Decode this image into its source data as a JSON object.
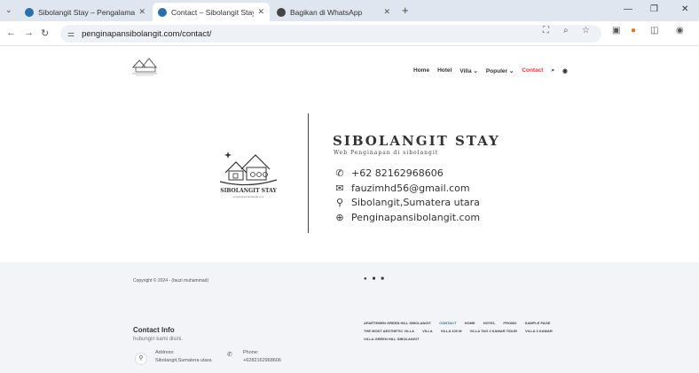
{
  "browser": {
    "tabs": [
      {
        "title": "Sibolangit Stay – Pengalaman I",
        "active": false
      },
      {
        "title": "Contact – Sibolangit Stay",
        "active": true
      },
      {
        "title": "Bagikan di WhatsApp",
        "active": false
      }
    ],
    "url": "penginapansibolangit.com/contact/"
  },
  "header": {
    "nav": [
      "Home",
      "Hotel",
      "Villa ⌄",
      "Populer ⌄",
      "Contact"
    ]
  },
  "hero": {
    "brand": "SIBOLANGIT STAY",
    "tagline": "Web Penginapan di sibolangit",
    "logo_text": "SIBOLANGIT STAY",
    "logo_sub": "penginapansibolangit.com",
    "phone": "+62 82162968606",
    "email": "fauzimhd56@gmail.com",
    "location": "Sibolangit,Sumatera utara",
    "website": "Penginapansibolangit.com"
  },
  "footer": {
    "copyright": "Copyright © 2024 - (fauzi muhammad)",
    "contact_title": "Contact Info",
    "contact_sub": "hubungin kami disini.",
    "address_label": "Address:",
    "address_value": "Sibolangit,Sumatera utara",
    "phone_label": "Phone:",
    "phone_value": "+6282162968606",
    "links": [
      "APARTEMEN GREEN HILL SIBOLANGIT",
      "CONTACT",
      "HOME",
      "HOTEL",
      "PROMO",
      "SAMPLE PAGE",
      "THE MOST AESTHETIC VILLA",
      "VILLA",
      "VILLA 100 M",
      "VILLA TAG 2 KAMAR TIDUR",
      "VILLA 3 KAMAR",
      "VILLA GREEN HILL SIBOLANGIT"
    ]
  },
  "colors": {
    "accent": "#e0393e",
    "link_active": "#2a6fa8"
  }
}
